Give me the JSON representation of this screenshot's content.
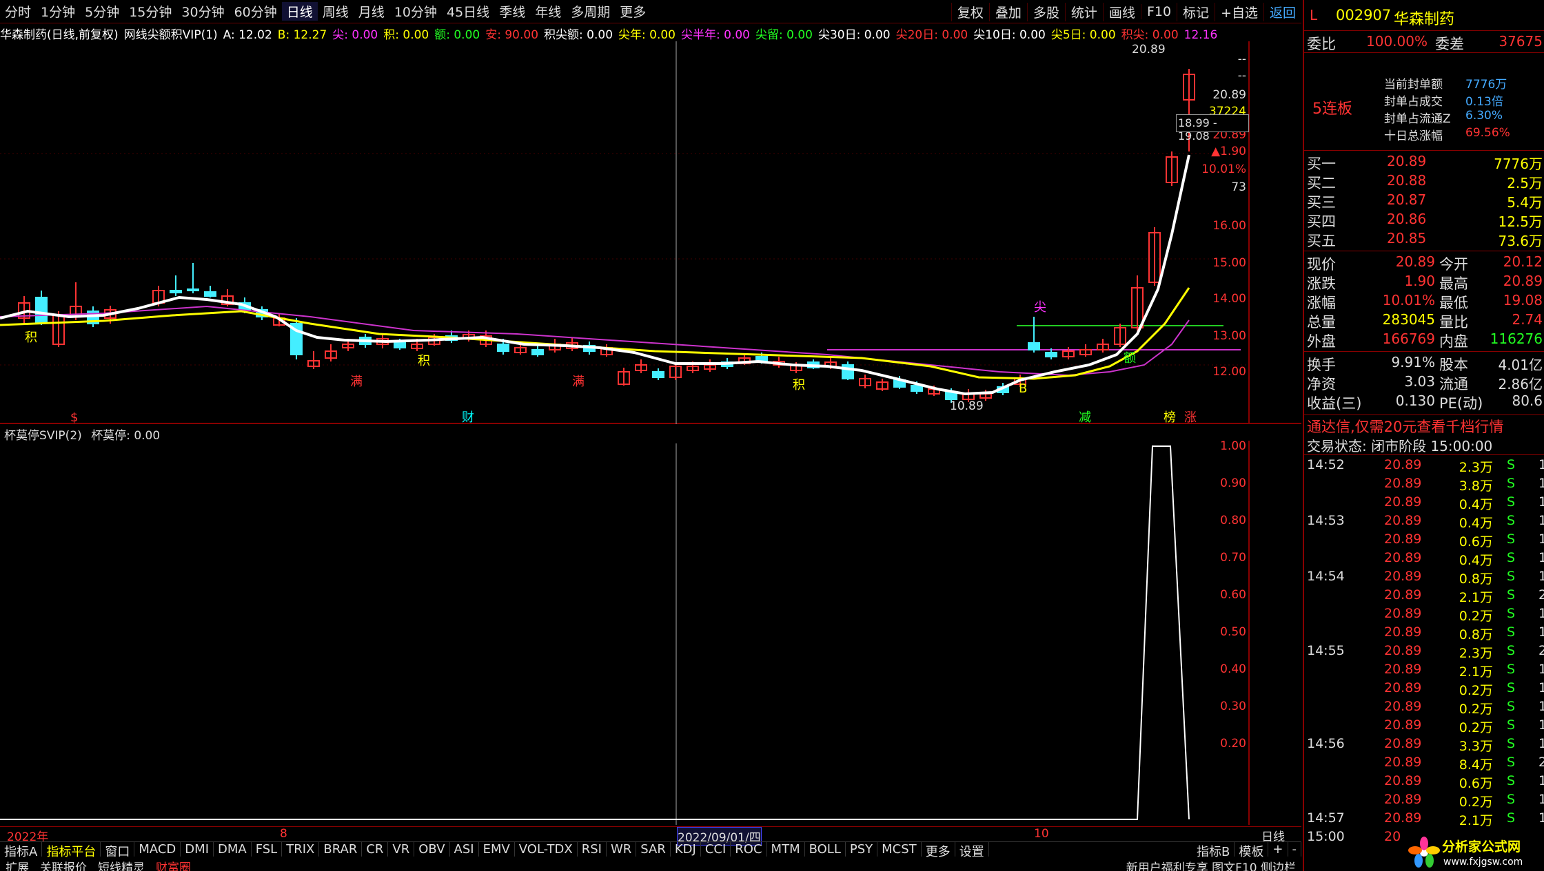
{
  "periods": [
    "分时",
    "1分钟",
    "5分钟",
    "15分钟",
    "30分钟",
    "60分钟",
    "日线",
    "周线",
    "月线",
    "10分钟",
    "45日线",
    "季线",
    "年线",
    "多周期",
    "更多"
  ],
  "active_period": "日线",
  "right_toolbar": [
    "复权",
    "叠加",
    "多股",
    "统计",
    "画线",
    "F10",
    "标记",
    "+自选"
  ],
  "return_label": "返回",
  "indicator_line": [
    {
      "t": "华森制药(日线,前复权)",
      "c": "w"
    },
    {
      "t": "网线尖额积VIP(1)",
      "c": "w"
    },
    {
      "t": "A: 12.02",
      "c": "w"
    },
    {
      "t": "B: 12.27",
      "c": "y"
    },
    {
      "t": "尖: 0.00",
      "c": "m"
    },
    {
      "t": "积: 0.00",
      "c": "y"
    },
    {
      "t": "额: 0.00",
      "c": "g"
    },
    {
      "t": "安: 90.00",
      "c": "r"
    },
    {
      "t": "积尖额: 0.00",
      "c": "w"
    },
    {
      "t": "尖年: 0.00",
      "c": "y"
    },
    {
      "t": "尖半年: 0.00",
      "c": "m"
    },
    {
      "t": "尖留: 0.00",
      "c": "g"
    },
    {
      "t": "尖30日: 0.00",
      "c": "w"
    },
    {
      "t": "尖20日: 0.00",
      "c": "r"
    },
    {
      "t": "尖10日: 0.00",
      "c": "w"
    },
    {
      "t": "尖5日: 0.00",
      "c": "y"
    },
    {
      "t": "积尖: 0.00",
      "c": "r"
    },
    {
      "t": "12.16",
      "c": "m"
    }
  ],
  "main_axis": {
    "labels": [
      "--",
      "--",
      "20.89",
      "37224",
      "20.89",
      "▲1.90",
      "10.01%",
      "73",
      "16.00",
      "15.00",
      "14.00",
      "13.00",
      "12.00"
    ]
  },
  "price_annotations": {
    "high": "20.89",
    "low": "10.89",
    "range_box": "18.99 - 19.08"
  },
  "signals": [
    {
      "t": "积",
      "c": "y"
    },
    {
      "t": "满",
      "c": "r"
    },
    {
      "t": "积",
      "c": "y"
    },
    {
      "t": "满",
      "c": "r"
    },
    {
      "t": "积",
      "c": "y"
    },
    {
      "t": "尖",
      "c": "m"
    },
    {
      "t": "B",
      "c": "y"
    },
    {
      "t": "额",
      "c": "g"
    }
  ],
  "bottom_marks": [
    {
      "t": "$",
      "c": "r"
    },
    {
      "t": "财",
      "c": "c"
    },
    {
      "t": "减",
      "c": "g"
    },
    {
      "t": "榜",
      "c": "y"
    },
    {
      "t": "涨",
      "c": "r"
    }
  ],
  "sub_header": "杯莫停SVIP(2)",
  "sub_value": "杯莫停: 0.00",
  "sub_axis": [
    "1.00",
    "0.90",
    "0.80",
    "0.70",
    "0.60",
    "0.50",
    "0.40",
    "0.30",
    "0.20"
  ],
  "date_bar": {
    "year": "2022年",
    "m8": "8",
    "cursor": "2022/09/01/四",
    "m10": "10",
    "mode": "日线"
  },
  "tabs": [
    "指标A",
    "指标平台",
    "窗口",
    "MACD",
    "DMI",
    "DMA",
    "FSL",
    "TRIX",
    "BRAR",
    "CR",
    "VR",
    "OBV",
    "ASI",
    "EMV",
    "VOL-TDX",
    "RSI",
    "WR",
    "SAR",
    "KDJ",
    "CCI",
    "ROC",
    "MTM",
    "BOLL",
    "PSY",
    "MCST",
    "更多",
    "设置"
  ],
  "tabs_right": [
    "指标B",
    "模板",
    "+",
    "-"
  ],
  "tabs2": [
    "扩展",
    "关联报价",
    "短线精灵",
    "财富圈"
  ],
  "tabs2_right": "新用户福利专享 图文F10 侧边栏",
  "stock": {
    "flag": "L",
    "code": "002907",
    "name": "华森制药"
  },
  "weibi": {
    "label": "委比",
    "value": "100.00%",
    "label2": "委差",
    "value2": "37675"
  },
  "seal": {
    "streak": "5连板",
    "rows": [
      {
        "k": "当前封单额",
        "v": "7776万"
      },
      {
        "k": "封单占成交",
        "v": "0.13倍"
      },
      {
        "k": "封单占流通Z",
        "v": "6.30%"
      },
      {
        "k": "十日总涨幅",
        "v": "69.56%"
      }
    ]
  },
  "bids": [
    {
      "k": "买一",
      "p": "20.89",
      "v": "7776万"
    },
    {
      "k": "买二",
      "p": "20.88",
      "v": "2.5万"
    },
    {
      "k": "买三",
      "p": "20.87",
      "v": "5.4万"
    },
    {
      "k": "买四",
      "p": "20.86",
      "v": "12.5万"
    },
    {
      "k": "买五",
      "p": "20.85",
      "v": "73.6万"
    }
  ],
  "quote": [
    {
      "k": "现价",
      "v": "20.89",
      "k2": "今开",
      "v2": "20.12"
    },
    {
      "k": "涨跌",
      "v": "1.90",
      "k2": "最高",
      "v2": "20.89"
    },
    {
      "k": "涨幅",
      "v": "10.01%",
      "k2": "最低",
      "v2": "19.08"
    },
    {
      "k": "总量",
      "v": "283045",
      "k2": "量比",
      "v2": "2.74"
    },
    {
      "k": "外盘",
      "v": "166769",
      "k2": "内盘",
      "v2": "116276"
    }
  ],
  "fund": [
    {
      "k": "换手",
      "v": "9.91%",
      "k2": "股本",
      "v2": "4.01亿"
    },
    {
      "k": "净资",
      "v": "3.03",
      "k2": "流通",
      "v2": "2.86亿"
    },
    {
      "k": "收益(三)",
      "v": "0.130",
      "k2": "PE(动)",
      "v2": "80.6"
    }
  ],
  "ad": "通达信,仅需20元查看千档行情",
  "trade_status": "交易状态: 闭市阶段 15:00:00",
  "ticks": [
    {
      "t": "14:52",
      "p": "20.89",
      "v": "2.3万",
      "s": "S",
      "n": "1"
    },
    {
      "t": "",
      "p": "20.89",
      "v": "3.8万",
      "s": "S",
      "n": "1"
    },
    {
      "t": "",
      "p": "20.89",
      "v": "0.4万",
      "s": "S",
      "n": "1"
    },
    {
      "t": "14:53",
      "p": "20.89",
      "v": "0.4万",
      "s": "S",
      "n": "1"
    },
    {
      "t": "",
      "p": "20.89",
      "v": "0.6万",
      "s": "S",
      "n": "1"
    },
    {
      "t": "",
      "p": "20.89",
      "v": "0.4万",
      "s": "S",
      "n": "1"
    },
    {
      "t": "14:54",
      "p": "20.89",
      "v": "0.8万",
      "s": "S",
      "n": "1"
    },
    {
      "t": "",
      "p": "20.89",
      "v": "2.1万",
      "s": "S",
      "n": "2"
    },
    {
      "t": "",
      "p": "20.89",
      "v": "0.2万",
      "s": "S",
      "n": "1"
    },
    {
      "t": "",
      "p": "20.89",
      "v": "0.8万",
      "s": "S",
      "n": "1"
    },
    {
      "t": "14:55",
      "p": "20.89",
      "v": "2.3万",
      "s": "S",
      "n": "2"
    },
    {
      "t": "",
      "p": "20.89",
      "v": "2.1万",
      "s": "S",
      "n": "1"
    },
    {
      "t": "",
      "p": "20.89",
      "v": "0.2万",
      "s": "S",
      "n": "1"
    },
    {
      "t": "",
      "p": "20.89",
      "v": "0.2万",
      "s": "S",
      "n": "1"
    },
    {
      "t": "",
      "p": "20.89",
      "v": "0.2万",
      "s": "S",
      "n": "1"
    },
    {
      "t": "14:56",
      "p": "20.89",
      "v": "3.3万",
      "s": "S",
      "n": "1"
    },
    {
      "t": "",
      "p": "20.89",
      "v": "8.4万",
      "s": "S",
      "n": "2"
    },
    {
      "t": "",
      "p": "20.89",
      "v": "0.6万",
      "s": "S",
      "n": "1"
    },
    {
      "t": "",
      "p": "20.89",
      "v": "0.2万",
      "s": "S",
      "n": "1"
    },
    {
      "t": "14:57",
      "p": "20.89",
      "v": "2.1万",
      "s": "S",
      "n": "1"
    },
    {
      "t": "15:00",
      "p": "20",
      "v": "",
      "s": "",
      "n": ""
    }
  ],
  "logo": {
    "name": "分析家公式网",
    "url": "www.fxjgsw.com"
  }
}
